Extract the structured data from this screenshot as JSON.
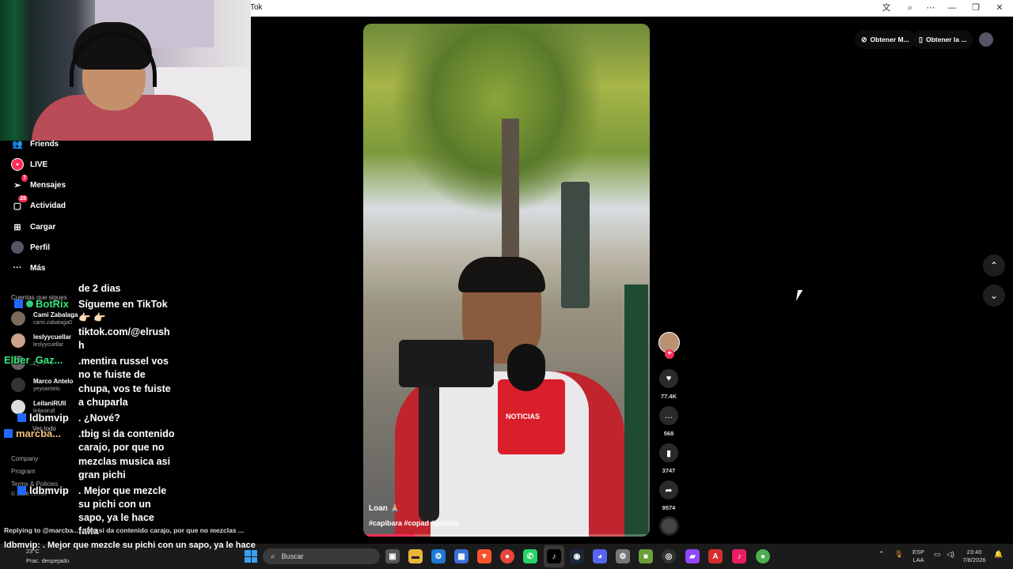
{
  "window": {
    "title": "Tok"
  },
  "sidebar": {
    "nav": [
      {
        "label": "Friends",
        "icon": "friends-icon"
      },
      {
        "label": "LIVE",
        "icon": "live-icon"
      },
      {
        "label": "Mensajes",
        "icon": "messages-icon",
        "badge": "7"
      },
      {
        "label": "Actividad",
        "icon": "activity-icon",
        "badge": "28"
      },
      {
        "label": "Cargar",
        "icon": "upload-icon"
      },
      {
        "label": "Perfil",
        "icon": "profile-icon"
      },
      {
        "label": "Más",
        "icon": "more-icon"
      }
    ],
    "following_heading": "Cuentas que sigues",
    "accounts": [
      {
        "name": "Cami Zabalaga",
        "handle": "cami.zabalaga0"
      },
      {
        "name": "leslyycuellar",
        "handle": "leslyycuellar"
      },
      {
        "name": "",
        "handle": "z_abcaj"
      },
      {
        "name": "Marco Antelo",
        "handle": "yeyoantelo"
      },
      {
        "name": "LeilaniRUll",
        "handle": "leilanirull"
      }
    ],
    "see_all": "Ver todo",
    "footer": [
      "Company",
      "Program",
      "Terms & Policies",
      "© 2026 TikTok"
    ]
  },
  "chat": {
    "messages": [
      {
        "user": "",
        "lines": [
          "de 2 dias"
        ]
      },
      {
        "user": "BotRix",
        "user_color": "#36e87d",
        "lines": [
          "Sígueme en TikTok",
          "👉🏻 👉🏻",
          "tiktok.com/@elrush",
          "h"
        ]
      },
      {
        "user": "Elber_Gaz...",
        "user_color": "#36e87d",
        "lines": [
          ".mentira russel vos",
          "no te fuiste de",
          "chupa, vos te fuiste",
          "a chuparla"
        ]
      },
      {
        "user": "ldbmvip",
        "user_color": "#ffffff",
        "lines": [
          ". ¿Nové?"
        ]
      },
      {
        "user": "marcba...",
        "user_color": "#f1c07a",
        "lines": [
          ".tbig si da contenido",
          "carajo, por que no",
          "mezclas musica asi",
          "gran pichi"
        ]
      },
      {
        "user": "ldbmvip",
        "user_color": "#ffffff",
        "lines": [
          ". Mejor que mezcle",
          "su pichi con un",
          "sapo, ya le hace",
          "falta"
        ]
      }
    ],
    "reply_text": "Replying to @marcba...: .tbig si da contenido carajo, por que no mezclas ...",
    "bottom_message": "ldbmvip: . Mejor que mezcle su pichi con un sapo, ya le hace"
  },
  "video": {
    "author": "Loan 🙏🏼",
    "tags": "#capibara #copad #guerita",
    "mic_label": "NOTICIAS",
    "progress": 0.18
  },
  "actions": {
    "likes": "77.4K",
    "comments": "568",
    "saves": "3747",
    "shares": "9574"
  },
  "top_bar": {
    "coins_button": "Obtener M...",
    "app_button": "Obtener la ..."
  },
  "taskbar": {
    "weather_temp": "23°C",
    "weather_desc": "Prac. despejado",
    "search_placeholder": "Buscar",
    "lang_line1": "ESP",
    "lang_line2": "LAA",
    "time": "23:40",
    "date": "7/8/2026"
  },
  "colors": {
    "accent": "#fe2c55",
    "background": "#000000",
    "twitch_blue": "#1f69ff"
  }
}
